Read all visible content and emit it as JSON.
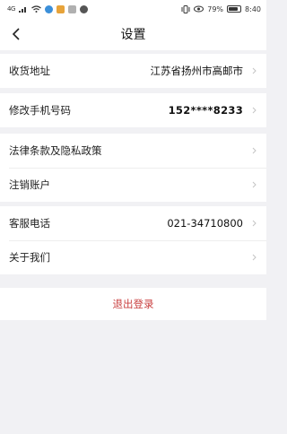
{
  "status_bar": {
    "signal": "4G",
    "battery": "79%",
    "time": "8:40"
  },
  "navbar": {
    "title": "设置"
  },
  "settings": {
    "address": {
      "label": "收货地址",
      "value": "江苏省扬州市高邮市"
    },
    "phone": {
      "label": "修改手机号码",
      "value": "152****8233"
    },
    "legal": {
      "label": "法律条款及隐私政策"
    },
    "cancel_account": {
      "label": "注销账户"
    },
    "service_phone": {
      "label": "客服电话",
      "value": "021-34710800"
    },
    "about": {
      "label": "关于我们"
    }
  },
  "logout": {
    "label": "退出登录"
  },
  "colors": {
    "background": "#f1f1f4",
    "logout_text": "#c94040",
    "chevron": "#c4c4c4"
  }
}
